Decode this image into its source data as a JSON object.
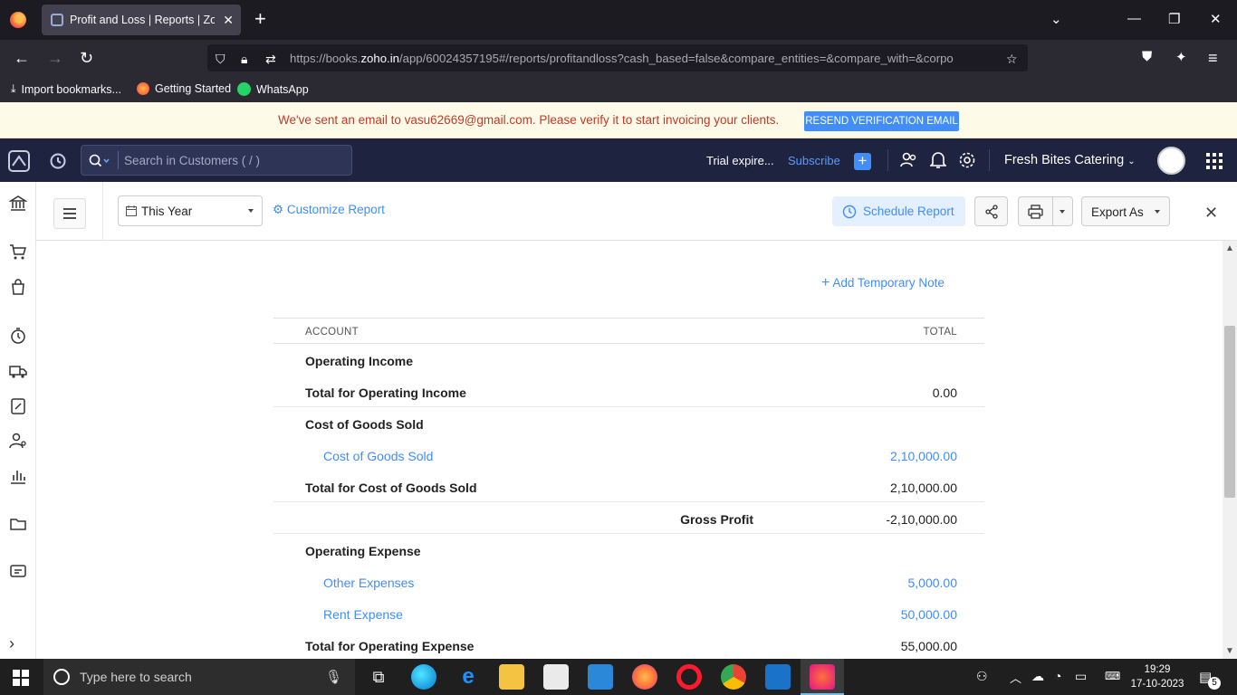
{
  "browser": {
    "tab_title": "Profit and Loss | Reports | Zoho",
    "url_prefix": "https://books.",
    "url_host": "zoho.in",
    "url_rest": "/app/60024357195#/reports/profitandloss?cash_based=false&compare_entities=&compare_with=&corpo",
    "bookmarks": [
      "Import bookmarks...",
      "Getting Started",
      "WhatsApp"
    ]
  },
  "banner": {
    "message": "We've sent an email to vasu62669@gmail.com. Please verify it to start invoicing your clients.",
    "button": "RESEND VERIFICATION EMAIL"
  },
  "header": {
    "search_placeholder": "Search in Customers ( / )",
    "trial": "Trial expire...",
    "subscribe": "Subscribe",
    "plus": "+",
    "organization": "Fresh Bites Catering"
  },
  "toolbar": {
    "period": "This Year",
    "customize": "Customize Report",
    "schedule": "Schedule Report",
    "export": "Export As"
  },
  "report": {
    "add_note": "Add Temporary Note",
    "col_account": "ACCOUNT",
    "col_total": "TOTAL",
    "rows": [
      {
        "label": "Operating Income",
        "value": ""
      },
      {
        "label": "Total for Operating Income",
        "value": "0.00"
      },
      {
        "label": "Cost of Goods Sold",
        "value": ""
      },
      {
        "label": "Cost of Goods Sold",
        "value": "2,10,000.00"
      },
      {
        "label": "Total for Cost of Goods Sold",
        "value": "2,10,000.00"
      },
      {
        "label": "Gross Profit",
        "value": "-2,10,000.00"
      },
      {
        "label": "Operating Expense",
        "value": ""
      },
      {
        "label": "Other Expenses",
        "value": "5,000.00"
      },
      {
        "label": "Rent Expense",
        "value": "50,000.00"
      },
      {
        "label": "Total for Operating Expense",
        "value": "55,000.00"
      }
    ]
  },
  "taskbar": {
    "search_placeholder": "Type here to search",
    "time": "19:29",
    "date": "17-10-2023",
    "notification_count": "5"
  },
  "colors": {
    "accent": "#408dfb",
    "app_header": "#1e2340",
    "banner_text": "#c0392b"
  }
}
